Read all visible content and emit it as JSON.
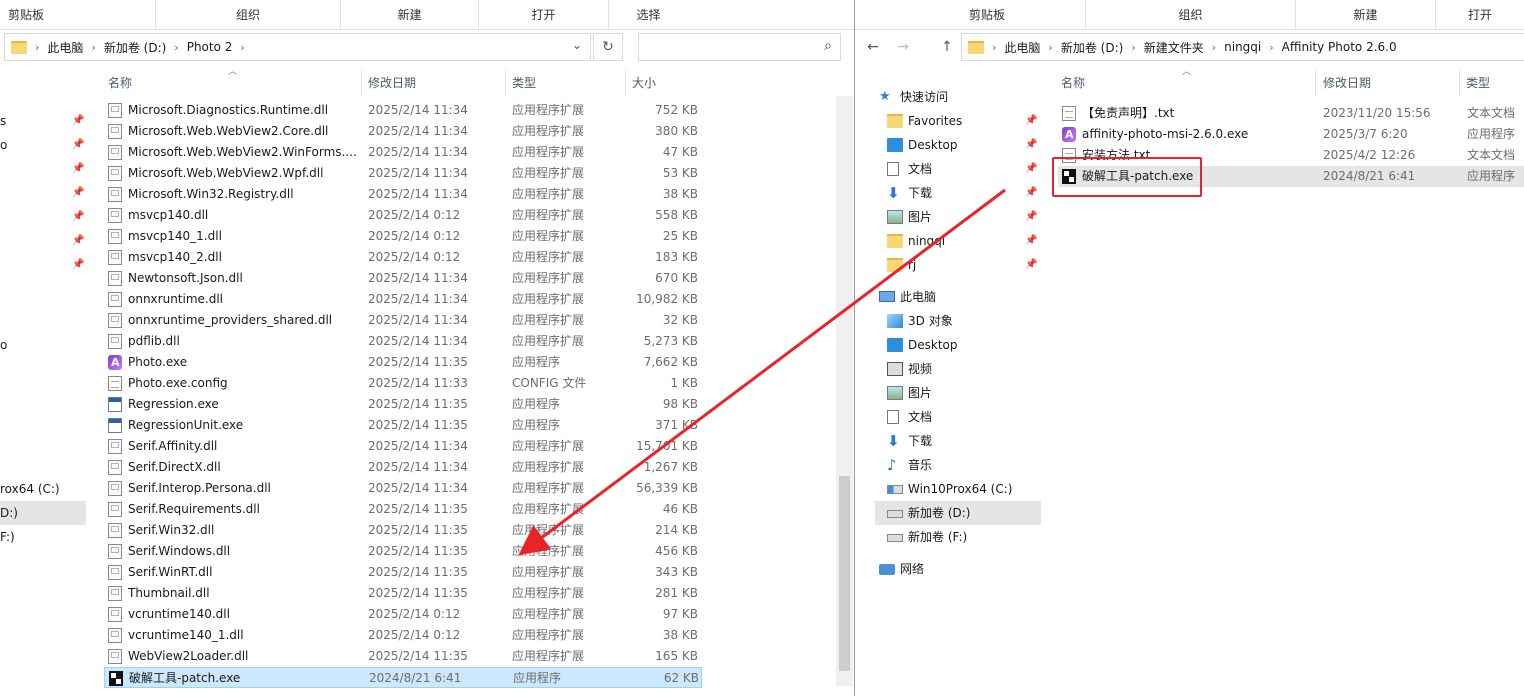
{
  "left": {
    "ribbon": [
      "剪贴板",
      "组织",
      "新建",
      "打开",
      "选择"
    ],
    "breadcrumb": [
      "此电脑",
      "新加卷 (D:)",
      "Photo 2"
    ],
    "nav_fragments": [
      "s",
      "o",
      "o",
      "rox64 (C:)",
      "D:)",
      "F:)"
    ],
    "columns": {
      "name": "名称",
      "date": "修改日期",
      "type": "类型",
      "size": "大小"
    },
    "files": [
      {
        "name": "Microsoft.Diagnostics.Runtime.dll",
        "date": "2025/2/14 11:34",
        "type": "应用程序扩展",
        "size": "752 KB",
        "icon": "dll"
      },
      {
        "name": "Microsoft.Web.WebView2.Core.dll",
        "date": "2025/2/14 11:34",
        "type": "应用程序扩展",
        "size": "380 KB",
        "icon": "dll"
      },
      {
        "name": "Microsoft.Web.WebView2.WinForms....",
        "date": "2025/2/14 11:34",
        "type": "应用程序扩展",
        "size": "47 KB",
        "icon": "dll"
      },
      {
        "name": "Microsoft.Web.WebView2.Wpf.dll",
        "date": "2025/2/14 11:34",
        "type": "应用程序扩展",
        "size": "53 KB",
        "icon": "dll"
      },
      {
        "name": "Microsoft.Win32.Registry.dll",
        "date": "2025/2/14 11:34",
        "type": "应用程序扩展",
        "size": "38 KB",
        "icon": "dll"
      },
      {
        "name": "msvcp140.dll",
        "date": "2025/2/14 0:12",
        "type": "应用程序扩展",
        "size": "558 KB",
        "icon": "dll"
      },
      {
        "name": "msvcp140_1.dll",
        "date": "2025/2/14 0:12",
        "type": "应用程序扩展",
        "size": "25 KB",
        "icon": "dll"
      },
      {
        "name": "msvcp140_2.dll",
        "date": "2025/2/14 0:12",
        "type": "应用程序扩展",
        "size": "183 KB",
        "icon": "dll"
      },
      {
        "name": "Newtonsoft.Json.dll",
        "date": "2025/2/14 11:34",
        "type": "应用程序扩展",
        "size": "670 KB",
        "icon": "dll"
      },
      {
        "name": "onnxruntime.dll",
        "date": "2025/2/14 11:34",
        "type": "应用程序扩展",
        "size": "10,982 KB",
        "icon": "dll"
      },
      {
        "name": "onnxruntime_providers_shared.dll",
        "date": "2025/2/14 11:34",
        "type": "应用程序扩展",
        "size": "32 KB",
        "icon": "dll"
      },
      {
        "name": "pdflib.dll",
        "date": "2025/2/14 11:34",
        "type": "应用程序扩展",
        "size": "5,273 KB",
        "icon": "dll"
      },
      {
        "name": "Photo.exe",
        "date": "2025/2/14 11:35",
        "type": "应用程序",
        "size": "7,662 KB",
        "icon": "affinity"
      },
      {
        "name": "Photo.exe.config",
        "date": "2025/2/14 11:33",
        "type": "CONFIG 文件",
        "size": "1 KB",
        "icon": "txt"
      },
      {
        "name": "Regression.exe",
        "date": "2025/2/14 11:35",
        "type": "应用程序",
        "size": "98 KB",
        "icon": "exe"
      },
      {
        "name": "RegressionUnit.exe",
        "date": "2025/2/14 11:35",
        "type": "应用程序",
        "size": "371 KB",
        "icon": "exe"
      },
      {
        "name": "Serif.Affinity.dll",
        "date": "2025/2/14 11:34",
        "type": "应用程序扩展",
        "size": "15,701 KB",
        "icon": "dll"
      },
      {
        "name": "Serif.DirectX.dll",
        "date": "2025/2/14 11:34",
        "type": "应用程序扩展",
        "size": "1,267 KB",
        "icon": "dll"
      },
      {
        "name": "Serif.Interop.Persona.dll",
        "date": "2025/2/14 11:34",
        "type": "应用程序扩展",
        "size": "56,339 KB",
        "icon": "dll"
      },
      {
        "name": "Serif.Requirements.dll",
        "date": "2025/2/14 11:35",
        "type": "应用程序扩展",
        "size": "46 KB",
        "icon": "dll"
      },
      {
        "name": "Serif.Win32.dll",
        "date": "2025/2/14 11:35",
        "type": "应用程序扩展",
        "size": "214 KB",
        "icon": "dll"
      },
      {
        "name": "Serif.Windows.dll",
        "date": "2025/2/14 11:35",
        "type": "应用程序扩展",
        "size": "456 KB",
        "icon": "dll"
      },
      {
        "name": "Serif.WinRT.dll",
        "date": "2025/2/14 11:35",
        "type": "应用程序扩展",
        "size": "343 KB",
        "icon": "dll"
      },
      {
        "name": "Thumbnail.dll",
        "date": "2025/2/14 11:35",
        "type": "应用程序扩展",
        "size": "281 KB",
        "icon": "dll"
      },
      {
        "name": "vcruntime140.dll",
        "date": "2025/2/14 0:12",
        "type": "应用程序扩展",
        "size": "97 KB",
        "icon": "dll"
      },
      {
        "name": "vcruntime140_1.dll",
        "date": "2025/2/14 0:12",
        "type": "应用程序扩展",
        "size": "38 KB",
        "icon": "dll"
      },
      {
        "name": "WebView2Loader.dll",
        "date": "2025/2/14 11:35",
        "type": "应用程序扩展",
        "size": "165 KB",
        "icon": "dll"
      },
      {
        "name": "破解工具-patch.exe",
        "date": "2024/8/21 6:41",
        "type": "应用程序",
        "size": "62 KB",
        "icon": "patch",
        "selected": true
      }
    ]
  },
  "right": {
    "ribbon": [
      "剪贴板",
      "组织",
      "新建",
      "打开"
    ],
    "breadcrumb": [
      "此电脑",
      "新加卷 (D:)",
      "新建文件夹",
      "ningqi",
      "Affinity Photo 2.6.0"
    ],
    "nav_buttons": {
      "back": "←",
      "forward": "→",
      "up": "↑"
    },
    "columns": {
      "name": "名称",
      "date": "修改日期",
      "type": "类型"
    },
    "nav": [
      {
        "label": "快速访问",
        "icon": "star",
        "indent": 0
      },
      {
        "label": "Favorites",
        "icon": "folder",
        "indent": 1,
        "pinned": true
      },
      {
        "label": "Desktop",
        "icon": "blue",
        "indent": 1,
        "pinned": true
      },
      {
        "label": "文档",
        "icon": "doc",
        "indent": 1,
        "pinned": true
      },
      {
        "label": "下载",
        "icon": "down",
        "indent": 1,
        "pinned": true
      },
      {
        "label": "图片",
        "icon": "img",
        "indent": 1,
        "pinned": true
      },
      {
        "label": "ningqi",
        "icon": "folder",
        "indent": 1,
        "pinned": true
      },
      {
        "label": "rj",
        "icon": "folder",
        "indent": 1,
        "pinned": true
      },
      {
        "label": "此电脑",
        "icon": "pc",
        "indent": 0,
        "gap": true
      },
      {
        "label": "3D 对象",
        "icon": "3d",
        "indent": 1
      },
      {
        "label": "Desktop",
        "icon": "blue",
        "indent": 1
      },
      {
        "label": "视频",
        "icon": "video",
        "indent": 1
      },
      {
        "label": "图片",
        "icon": "img",
        "indent": 1
      },
      {
        "label": "文档",
        "icon": "doc",
        "indent": 1
      },
      {
        "label": "下载",
        "icon": "down",
        "indent": 1
      },
      {
        "label": "音乐",
        "icon": "music",
        "indent": 1
      },
      {
        "label": "Win10Prox64 (C:)",
        "icon": "drive-c",
        "indent": 1
      },
      {
        "label": "新加卷 (D:)",
        "icon": "drive",
        "indent": 1,
        "selected": true
      },
      {
        "label": "新加卷 (F:)",
        "icon": "drive",
        "indent": 1
      },
      {
        "label": "网络",
        "icon": "net",
        "indent": 0,
        "gap": true
      }
    ],
    "files": [
      {
        "name": "【免责声明】.txt",
        "date": "2023/11/20 15:56",
        "type": "文本文档",
        "icon": "txt"
      },
      {
        "name": "affinity-photo-msi-2.6.0.exe",
        "date": "2025/3/7 6:20",
        "type": "应用程序",
        "icon": "affinity"
      },
      {
        "name": "安装方法.txt",
        "date": "2025/4/2 12:26",
        "type": "文本文档",
        "icon": "txt"
      },
      {
        "name": "破解工具-patch.exe",
        "date": "2024/8/21 6:41",
        "type": "应用程序",
        "icon": "patch",
        "hover": true
      }
    ]
  },
  "colors": {
    "selected_bg": "#cce8ff",
    "hover_bg": "#e5e5e5",
    "annotation_red": "#e8232a"
  }
}
